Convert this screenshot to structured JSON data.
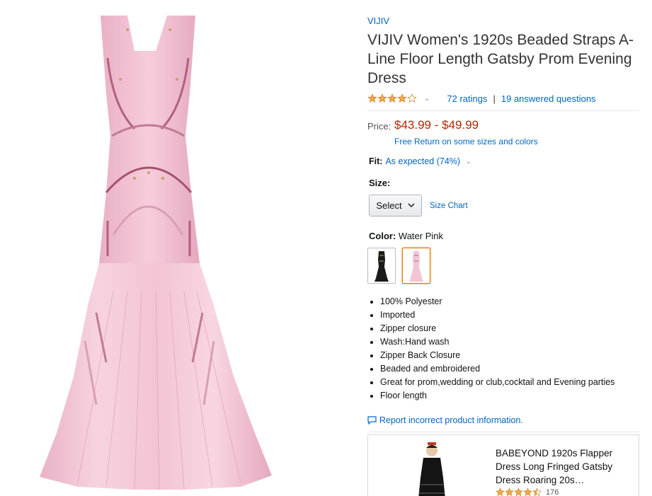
{
  "product": {
    "brand": "VIJIV",
    "title": "VIJIV Women's 1920s Beaded Straps A-Line Floor Length Gatsby Prom Evening Dress",
    "rating": 4,
    "ratings_count": "72 ratings",
    "answered": "19 answered questions",
    "price_label": "Price:",
    "price": "$43.99 - $49.99",
    "free_return": "Free Return on some sizes and colors",
    "fit_label": "Fit:",
    "fit_value": "As expected (74%)",
    "size_label": "Size:",
    "size_select": "Select",
    "size_chart": "Size Chart",
    "color_label": "Color:",
    "color_value": "Water Pink",
    "bullets": [
      "100% Polyester",
      "Imported",
      "Zipper closure",
      "Wash:Hand wash",
      "Zipper Back Closure",
      "Beaded and embroidered",
      "Great for prom,wedding or club,cocktail and Evening parties",
      "Floor length"
    ],
    "report": "Report incorrect product information."
  },
  "ad": {
    "title": "BABEYOND 1920s Flapper Dress Long Fringed Gatsby Dress Roaring 20s…",
    "rating": 4.5,
    "count": "176"
  },
  "colors": {
    "link": "#0066c0",
    "price": "#b12704",
    "star": "#f3a847",
    "dress_pink": "#f2c5d6",
    "selected_border": "#e77600"
  }
}
